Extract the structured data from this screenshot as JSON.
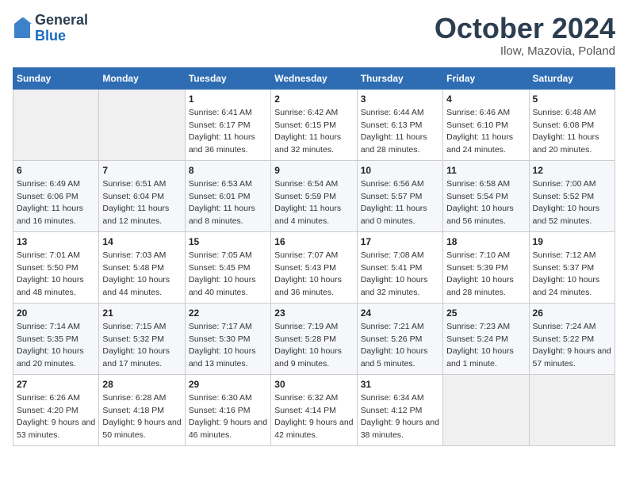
{
  "header": {
    "logo_general": "General",
    "logo_blue": "Blue",
    "month_title": "October 2024",
    "location": "Ilow, Mazovia, Poland"
  },
  "weekdays": [
    "Sunday",
    "Monday",
    "Tuesday",
    "Wednesday",
    "Thursday",
    "Friday",
    "Saturday"
  ],
  "weeks": [
    [
      {
        "day": "",
        "sunrise": "",
        "sunset": "",
        "daylight": "",
        "empty": true
      },
      {
        "day": "",
        "sunrise": "",
        "sunset": "",
        "daylight": "",
        "empty": true
      },
      {
        "day": "1",
        "sunrise": "Sunrise: 6:41 AM",
        "sunset": "Sunset: 6:17 PM",
        "daylight": "Daylight: 11 hours and 36 minutes.",
        "empty": false
      },
      {
        "day": "2",
        "sunrise": "Sunrise: 6:42 AM",
        "sunset": "Sunset: 6:15 PM",
        "daylight": "Daylight: 11 hours and 32 minutes.",
        "empty": false
      },
      {
        "day": "3",
        "sunrise": "Sunrise: 6:44 AM",
        "sunset": "Sunset: 6:13 PM",
        "daylight": "Daylight: 11 hours and 28 minutes.",
        "empty": false
      },
      {
        "day": "4",
        "sunrise": "Sunrise: 6:46 AM",
        "sunset": "Sunset: 6:10 PM",
        "daylight": "Daylight: 11 hours and 24 minutes.",
        "empty": false
      },
      {
        "day": "5",
        "sunrise": "Sunrise: 6:48 AM",
        "sunset": "Sunset: 6:08 PM",
        "daylight": "Daylight: 11 hours and 20 minutes.",
        "empty": false
      }
    ],
    [
      {
        "day": "6",
        "sunrise": "Sunrise: 6:49 AM",
        "sunset": "Sunset: 6:06 PM",
        "daylight": "Daylight: 11 hours and 16 minutes.",
        "empty": false
      },
      {
        "day": "7",
        "sunrise": "Sunrise: 6:51 AM",
        "sunset": "Sunset: 6:04 PM",
        "daylight": "Daylight: 11 hours and 12 minutes.",
        "empty": false
      },
      {
        "day": "8",
        "sunrise": "Sunrise: 6:53 AM",
        "sunset": "Sunset: 6:01 PM",
        "daylight": "Daylight: 11 hours and 8 minutes.",
        "empty": false
      },
      {
        "day": "9",
        "sunrise": "Sunrise: 6:54 AM",
        "sunset": "Sunset: 5:59 PM",
        "daylight": "Daylight: 11 hours and 4 minutes.",
        "empty": false
      },
      {
        "day": "10",
        "sunrise": "Sunrise: 6:56 AM",
        "sunset": "Sunset: 5:57 PM",
        "daylight": "Daylight: 11 hours and 0 minutes.",
        "empty": false
      },
      {
        "day": "11",
        "sunrise": "Sunrise: 6:58 AM",
        "sunset": "Sunset: 5:54 PM",
        "daylight": "Daylight: 10 hours and 56 minutes.",
        "empty": false
      },
      {
        "day": "12",
        "sunrise": "Sunrise: 7:00 AM",
        "sunset": "Sunset: 5:52 PM",
        "daylight": "Daylight: 10 hours and 52 minutes.",
        "empty": false
      }
    ],
    [
      {
        "day": "13",
        "sunrise": "Sunrise: 7:01 AM",
        "sunset": "Sunset: 5:50 PM",
        "daylight": "Daylight: 10 hours and 48 minutes.",
        "empty": false
      },
      {
        "day": "14",
        "sunrise": "Sunrise: 7:03 AM",
        "sunset": "Sunset: 5:48 PM",
        "daylight": "Daylight: 10 hours and 44 minutes.",
        "empty": false
      },
      {
        "day": "15",
        "sunrise": "Sunrise: 7:05 AM",
        "sunset": "Sunset: 5:45 PM",
        "daylight": "Daylight: 10 hours and 40 minutes.",
        "empty": false
      },
      {
        "day": "16",
        "sunrise": "Sunrise: 7:07 AM",
        "sunset": "Sunset: 5:43 PM",
        "daylight": "Daylight: 10 hours and 36 minutes.",
        "empty": false
      },
      {
        "day": "17",
        "sunrise": "Sunrise: 7:08 AM",
        "sunset": "Sunset: 5:41 PM",
        "daylight": "Daylight: 10 hours and 32 minutes.",
        "empty": false
      },
      {
        "day": "18",
        "sunrise": "Sunrise: 7:10 AM",
        "sunset": "Sunset: 5:39 PM",
        "daylight": "Daylight: 10 hours and 28 minutes.",
        "empty": false
      },
      {
        "day": "19",
        "sunrise": "Sunrise: 7:12 AM",
        "sunset": "Sunset: 5:37 PM",
        "daylight": "Daylight: 10 hours and 24 minutes.",
        "empty": false
      }
    ],
    [
      {
        "day": "20",
        "sunrise": "Sunrise: 7:14 AM",
        "sunset": "Sunset: 5:35 PM",
        "daylight": "Daylight: 10 hours and 20 minutes.",
        "empty": false
      },
      {
        "day": "21",
        "sunrise": "Sunrise: 7:15 AM",
        "sunset": "Sunset: 5:32 PM",
        "daylight": "Daylight: 10 hours and 17 minutes.",
        "empty": false
      },
      {
        "day": "22",
        "sunrise": "Sunrise: 7:17 AM",
        "sunset": "Sunset: 5:30 PM",
        "daylight": "Daylight: 10 hours and 13 minutes.",
        "empty": false
      },
      {
        "day": "23",
        "sunrise": "Sunrise: 7:19 AM",
        "sunset": "Sunset: 5:28 PM",
        "daylight": "Daylight: 10 hours and 9 minutes.",
        "empty": false
      },
      {
        "day": "24",
        "sunrise": "Sunrise: 7:21 AM",
        "sunset": "Sunset: 5:26 PM",
        "daylight": "Daylight: 10 hours and 5 minutes.",
        "empty": false
      },
      {
        "day": "25",
        "sunrise": "Sunrise: 7:23 AM",
        "sunset": "Sunset: 5:24 PM",
        "daylight": "Daylight: 10 hours and 1 minute.",
        "empty": false
      },
      {
        "day": "26",
        "sunrise": "Sunrise: 7:24 AM",
        "sunset": "Sunset: 5:22 PM",
        "daylight": "Daylight: 9 hours and 57 minutes.",
        "empty": false
      }
    ],
    [
      {
        "day": "27",
        "sunrise": "Sunrise: 6:26 AM",
        "sunset": "Sunset: 4:20 PM",
        "daylight": "Daylight: 9 hours and 53 minutes.",
        "empty": false
      },
      {
        "day": "28",
        "sunrise": "Sunrise: 6:28 AM",
        "sunset": "Sunset: 4:18 PM",
        "daylight": "Daylight: 9 hours and 50 minutes.",
        "empty": false
      },
      {
        "day": "29",
        "sunrise": "Sunrise: 6:30 AM",
        "sunset": "Sunset: 4:16 PM",
        "daylight": "Daylight: 9 hours and 46 minutes.",
        "empty": false
      },
      {
        "day": "30",
        "sunrise": "Sunrise: 6:32 AM",
        "sunset": "Sunset: 4:14 PM",
        "daylight": "Daylight: 9 hours and 42 minutes.",
        "empty": false
      },
      {
        "day": "31",
        "sunrise": "Sunrise: 6:34 AM",
        "sunset": "Sunset: 4:12 PM",
        "daylight": "Daylight: 9 hours and 38 minutes.",
        "empty": false
      },
      {
        "day": "",
        "sunrise": "",
        "sunset": "",
        "daylight": "",
        "empty": true
      },
      {
        "day": "",
        "sunrise": "",
        "sunset": "",
        "daylight": "",
        "empty": true
      }
    ]
  ]
}
